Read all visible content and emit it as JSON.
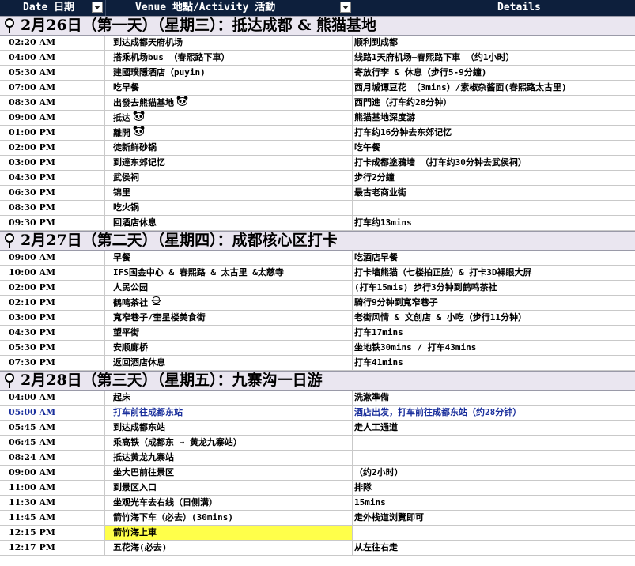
{
  "header": {
    "date_label": "Date 日期",
    "venue_label": "Venue 地點/Activity 活動",
    "details_label": "Details"
  },
  "days": [
    {
      "title": "2月26日（第一天）（星期三）：抵达成都 & 熊猫基地",
      "rows": [
        {
          "time": "02:20 AM",
          "venue": "到达成都天府机场",
          "details": "顺利到成都"
        },
        {
          "time": "04:00 AM",
          "venue": "搭乘机场bus （春熙路下車）",
          "details": "线路1天府机场—春熙路下車 （约1小时）"
        },
        {
          "time": "05:30 AM",
          "venue": "建國璞隱酒店（puyin)",
          "details": "寄放行李 & 休息（步行5-9分鐘)"
        },
        {
          "time": "07:00 AM",
          "venue": "吃早餐",
          "details": "西月城谭豆花 （3mins）/素椒杂酱面(春熙路太古里)"
        },
        {
          "time": "08:30 AM",
          "venue": "出發去熊猫基地",
          "details": "西門進（打车约28分钟）",
          "icon": "panda-icon"
        },
        {
          "time": "09:00 AM",
          "venue": "抵达",
          "details": "熊猫基地深度游",
          "icon": "panda-icon"
        },
        {
          "time": "01:00 PM",
          "venue": "離開",
          "details": "打车约16分钟去东郊记忆",
          "icon": "panda-icon"
        },
        {
          "time": "02:00 PM",
          "venue": "徒新鲜砂锅",
          "details": "吃午餐"
        },
        {
          "time": "03:00 PM",
          "venue": "到達东郊记忆",
          "details": "打卡成都塗鴉墙 （打车约30分钟去武侯祠）"
        },
        {
          "time": "04:30 PM",
          "venue": "武侯祠",
          "details": "步行2分鐘"
        },
        {
          "time": "06:30 PM",
          "venue": "锦里",
          "details": "最古老商业街"
        },
        {
          "time": "08:30 PM",
          "venue": "吃火锅",
          "details": ""
        },
        {
          "time": "09:30 PM",
          "venue": "回酒店休息",
          "details": "打车约13mins"
        }
      ]
    },
    {
      "title": "2月27日（第二天）（星期四）：成都核心区打卡",
      "rows": [
        {
          "time": "09:00 AM",
          "venue": "早餐",
          "details": "吃酒店早餐"
        },
        {
          "time": "10:00 AM",
          "venue": "IFS国金中心 & 春熙路 & 太古里 &太慈寺",
          "details": "打卡墙熊猫（七楼拍正脸）& 打卡3D裸眼大屏"
        },
        {
          "time": "02:00 PM",
          "venue": "人民公园",
          "details": "(打车15mis) 步行3分钟到鹤鸣茶社"
        },
        {
          "time": "02:10 PM",
          "venue": "鹤鸣茶社",
          "details": "騎行9分钟到寬窄巷子",
          "icon": "tea-icon"
        },
        {
          "time": "03:00 PM",
          "venue": "寬窄巷子/奎星楼美食街",
          "details": "老街风情 & 文创店 & 小吃（步行11分钟）"
        },
        {
          "time": "04:30 PM",
          "venue": "望平街",
          "details": "打车17mins"
        },
        {
          "time": "05:30 PM",
          "venue": "安顺廊桥",
          "details": "坐地铁30mins / 打车43mins"
        },
        {
          "time": "07:30 PM",
          "venue": "返回酒店休息",
          "details": "打车41mins"
        }
      ]
    },
    {
      "title": "2月28日（第三天）（星期五）：九寨沟一日游",
      "rows": [
        {
          "time": "04:00 AM",
          "venue": "起床",
          "details": "洗漱準備"
        },
        {
          "time": "05:00 AM",
          "venue": "打车前往成都东站",
          "details": "酒店出发，打车前往成都东站（约28分钟）",
          "style": "blue"
        },
        {
          "time": "05:45 AM",
          "venue": "到达成都东站",
          "details": "走人工通道"
        },
        {
          "time": "06:45 AM",
          "venue": "乘高铁（成都东 → 黄龙九寨站）",
          "details": ""
        },
        {
          "time": "08:24 AM",
          "venue": "抵达黄龙九寨站",
          "details": ""
        },
        {
          "time": "09:00 AM",
          "venue": "坐大巴前往景区",
          "details": "（约2小时）"
        },
        {
          "time": "11:00 AM",
          "venue": "到景区入口",
          "details": "排隊"
        },
        {
          "time": "11:30 AM",
          "venue": "坐观光车去右线（日侧溝）",
          "details": "15mins"
        },
        {
          "time": "11:45 AM",
          "venue": "箭竹海下车（必去）(30mins)",
          "details": "走外栈道浏覽即可"
        },
        {
          "time": "12:15 PM",
          "venue": "箭竹海上車",
          "details": "",
          "style": "highlight"
        },
        {
          "time": "12:17 PM",
          "venue": "五花海(必去)",
          "details": "从左往右走"
        }
      ]
    }
  ]
}
